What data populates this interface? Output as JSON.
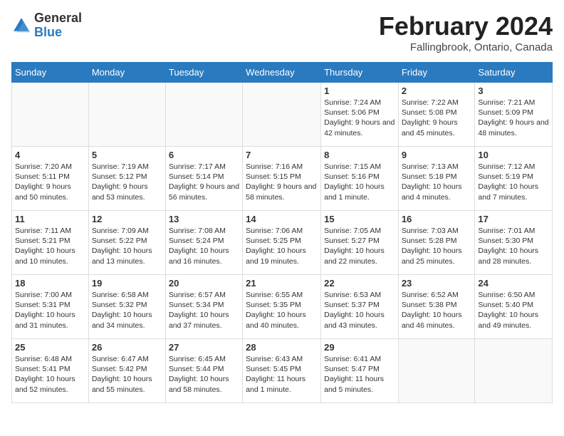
{
  "logo": {
    "general": "General",
    "blue": "Blue"
  },
  "header": {
    "month": "February 2024",
    "location": "Fallingbrook, Ontario, Canada"
  },
  "weekdays": [
    "Sunday",
    "Monday",
    "Tuesday",
    "Wednesday",
    "Thursday",
    "Friday",
    "Saturday"
  ],
  "weeks": [
    [
      {
        "day": "",
        "sunrise": "",
        "sunset": "",
        "daylight": ""
      },
      {
        "day": "",
        "sunrise": "",
        "sunset": "",
        "daylight": ""
      },
      {
        "day": "",
        "sunrise": "",
        "sunset": "",
        "daylight": ""
      },
      {
        "day": "",
        "sunrise": "",
        "sunset": "",
        "daylight": ""
      },
      {
        "day": "1",
        "sunrise": "Sunrise: 7:24 AM",
        "sunset": "Sunset: 5:06 PM",
        "daylight": "Daylight: 9 hours and 42 minutes."
      },
      {
        "day": "2",
        "sunrise": "Sunrise: 7:22 AM",
        "sunset": "Sunset: 5:08 PM",
        "daylight": "Daylight: 9 hours and 45 minutes."
      },
      {
        "day": "3",
        "sunrise": "Sunrise: 7:21 AM",
        "sunset": "Sunset: 5:09 PM",
        "daylight": "Daylight: 9 hours and 48 minutes."
      }
    ],
    [
      {
        "day": "4",
        "sunrise": "Sunrise: 7:20 AM",
        "sunset": "Sunset: 5:11 PM",
        "daylight": "Daylight: 9 hours and 50 minutes."
      },
      {
        "day": "5",
        "sunrise": "Sunrise: 7:19 AM",
        "sunset": "Sunset: 5:12 PM",
        "daylight": "Daylight: 9 hours and 53 minutes."
      },
      {
        "day": "6",
        "sunrise": "Sunrise: 7:17 AM",
        "sunset": "Sunset: 5:14 PM",
        "daylight": "Daylight: 9 hours and 56 minutes."
      },
      {
        "day": "7",
        "sunrise": "Sunrise: 7:16 AM",
        "sunset": "Sunset: 5:15 PM",
        "daylight": "Daylight: 9 hours and 58 minutes."
      },
      {
        "day": "8",
        "sunrise": "Sunrise: 7:15 AM",
        "sunset": "Sunset: 5:16 PM",
        "daylight": "Daylight: 10 hours and 1 minute."
      },
      {
        "day": "9",
        "sunrise": "Sunrise: 7:13 AM",
        "sunset": "Sunset: 5:18 PM",
        "daylight": "Daylight: 10 hours and 4 minutes."
      },
      {
        "day": "10",
        "sunrise": "Sunrise: 7:12 AM",
        "sunset": "Sunset: 5:19 PM",
        "daylight": "Daylight: 10 hours and 7 minutes."
      }
    ],
    [
      {
        "day": "11",
        "sunrise": "Sunrise: 7:11 AM",
        "sunset": "Sunset: 5:21 PM",
        "daylight": "Daylight: 10 hours and 10 minutes."
      },
      {
        "day": "12",
        "sunrise": "Sunrise: 7:09 AM",
        "sunset": "Sunset: 5:22 PM",
        "daylight": "Daylight: 10 hours and 13 minutes."
      },
      {
        "day": "13",
        "sunrise": "Sunrise: 7:08 AM",
        "sunset": "Sunset: 5:24 PM",
        "daylight": "Daylight: 10 hours and 16 minutes."
      },
      {
        "day": "14",
        "sunrise": "Sunrise: 7:06 AM",
        "sunset": "Sunset: 5:25 PM",
        "daylight": "Daylight: 10 hours and 19 minutes."
      },
      {
        "day": "15",
        "sunrise": "Sunrise: 7:05 AM",
        "sunset": "Sunset: 5:27 PM",
        "daylight": "Daylight: 10 hours and 22 minutes."
      },
      {
        "day": "16",
        "sunrise": "Sunrise: 7:03 AM",
        "sunset": "Sunset: 5:28 PM",
        "daylight": "Daylight: 10 hours and 25 minutes."
      },
      {
        "day": "17",
        "sunrise": "Sunrise: 7:01 AM",
        "sunset": "Sunset: 5:30 PM",
        "daylight": "Daylight: 10 hours and 28 minutes."
      }
    ],
    [
      {
        "day": "18",
        "sunrise": "Sunrise: 7:00 AM",
        "sunset": "Sunset: 5:31 PM",
        "daylight": "Daylight: 10 hours and 31 minutes."
      },
      {
        "day": "19",
        "sunrise": "Sunrise: 6:58 AM",
        "sunset": "Sunset: 5:32 PM",
        "daylight": "Daylight: 10 hours and 34 minutes."
      },
      {
        "day": "20",
        "sunrise": "Sunrise: 6:57 AM",
        "sunset": "Sunset: 5:34 PM",
        "daylight": "Daylight: 10 hours and 37 minutes."
      },
      {
        "day": "21",
        "sunrise": "Sunrise: 6:55 AM",
        "sunset": "Sunset: 5:35 PM",
        "daylight": "Daylight: 10 hours and 40 minutes."
      },
      {
        "day": "22",
        "sunrise": "Sunrise: 6:53 AM",
        "sunset": "Sunset: 5:37 PM",
        "daylight": "Daylight: 10 hours and 43 minutes."
      },
      {
        "day": "23",
        "sunrise": "Sunrise: 6:52 AM",
        "sunset": "Sunset: 5:38 PM",
        "daylight": "Daylight: 10 hours and 46 minutes."
      },
      {
        "day": "24",
        "sunrise": "Sunrise: 6:50 AM",
        "sunset": "Sunset: 5:40 PM",
        "daylight": "Daylight: 10 hours and 49 minutes."
      }
    ],
    [
      {
        "day": "25",
        "sunrise": "Sunrise: 6:48 AM",
        "sunset": "Sunset: 5:41 PM",
        "daylight": "Daylight: 10 hours and 52 minutes."
      },
      {
        "day": "26",
        "sunrise": "Sunrise: 6:47 AM",
        "sunset": "Sunset: 5:42 PM",
        "daylight": "Daylight: 10 hours and 55 minutes."
      },
      {
        "day": "27",
        "sunrise": "Sunrise: 6:45 AM",
        "sunset": "Sunset: 5:44 PM",
        "daylight": "Daylight: 10 hours and 58 minutes."
      },
      {
        "day": "28",
        "sunrise": "Sunrise: 6:43 AM",
        "sunset": "Sunset: 5:45 PM",
        "daylight": "Daylight: 11 hours and 1 minute."
      },
      {
        "day": "29",
        "sunrise": "Sunrise: 6:41 AM",
        "sunset": "Sunset: 5:47 PM",
        "daylight": "Daylight: 11 hours and 5 minutes."
      },
      {
        "day": "",
        "sunrise": "",
        "sunset": "",
        "daylight": ""
      },
      {
        "day": "",
        "sunrise": "",
        "sunset": "",
        "daylight": ""
      }
    ]
  ]
}
